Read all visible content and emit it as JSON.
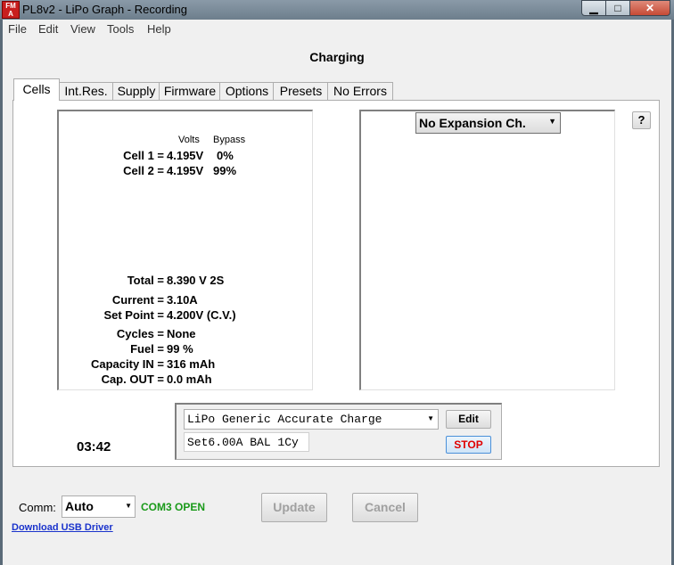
{
  "window": {
    "title": "PL8v2 - LiPo Graph - Recording",
    "icon_text_top": "FM",
    "icon_text_bottom": "A"
  },
  "window_controls": {
    "minimize": "▁",
    "maximize": "□",
    "close": "✕"
  },
  "menu": [
    "File",
    "Edit",
    "View",
    "Tools",
    "Help"
  ],
  "heading": "Charging",
  "tabs": [
    "Cells",
    "Int.Res.",
    "Supply",
    "Firmware",
    "Options",
    "Presets",
    "No Errors"
  ],
  "cells_panel": {
    "col_volts": "Volts",
    "col_bypass": "Bypass",
    "cells": [
      {
        "label": "Cell 1 =",
        "value": "4.195V",
        "bypass": "0%"
      },
      {
        "label": "Cell 2 =",
        "value": "4.195V",
        "bypass": "99%"
      }
    ],
    "stats": [
      {
        "label": "Total =",
        "value": "8.390 V  2S"
      },
      {
        "label": "Current =",
        "value": "3.10A"
      },
      {
        "label": "Set Point =",
        "value": "4.200V  (C.V.)"
      },
      {
        "label": "Cycles =",
        "value": "None"
      },
      {
        "label": "Fuel =",
        "value": "99 %"
      },
      {
        "label": "Capacity IN =",
        "value": "316 mAh"
      },
      {
        "label": "Cap. OUT =",
        "value": "0.0 mAh"
      }
    ]
  },
  "expansion": {
    "selected": "No Expansion Ch.",
    "help": "?"
  },
  "preset": {
    "selected": "LiPo Generic Accurate Charge",
    "summary": "Set6.00A BAL 1Cy",
    "edit_label": "Edit",
    "stop_label": "STOP"
  },
  "timer": "03:42",
  "footer": {
    "comm_label": "Comm:",
    "comm_value": "Auto",
    "comm_status": "COM3 OPEN",
    "driver_link": "Download USB Driver",
    "update_label": "Update",
    "cancel_label": "Cancel"
  },
  "colors": {
    "status_green": "#1a9a1a",
    "stop_red": "#e00000",
    "link_blue": "#1a33cc"
  }
}
